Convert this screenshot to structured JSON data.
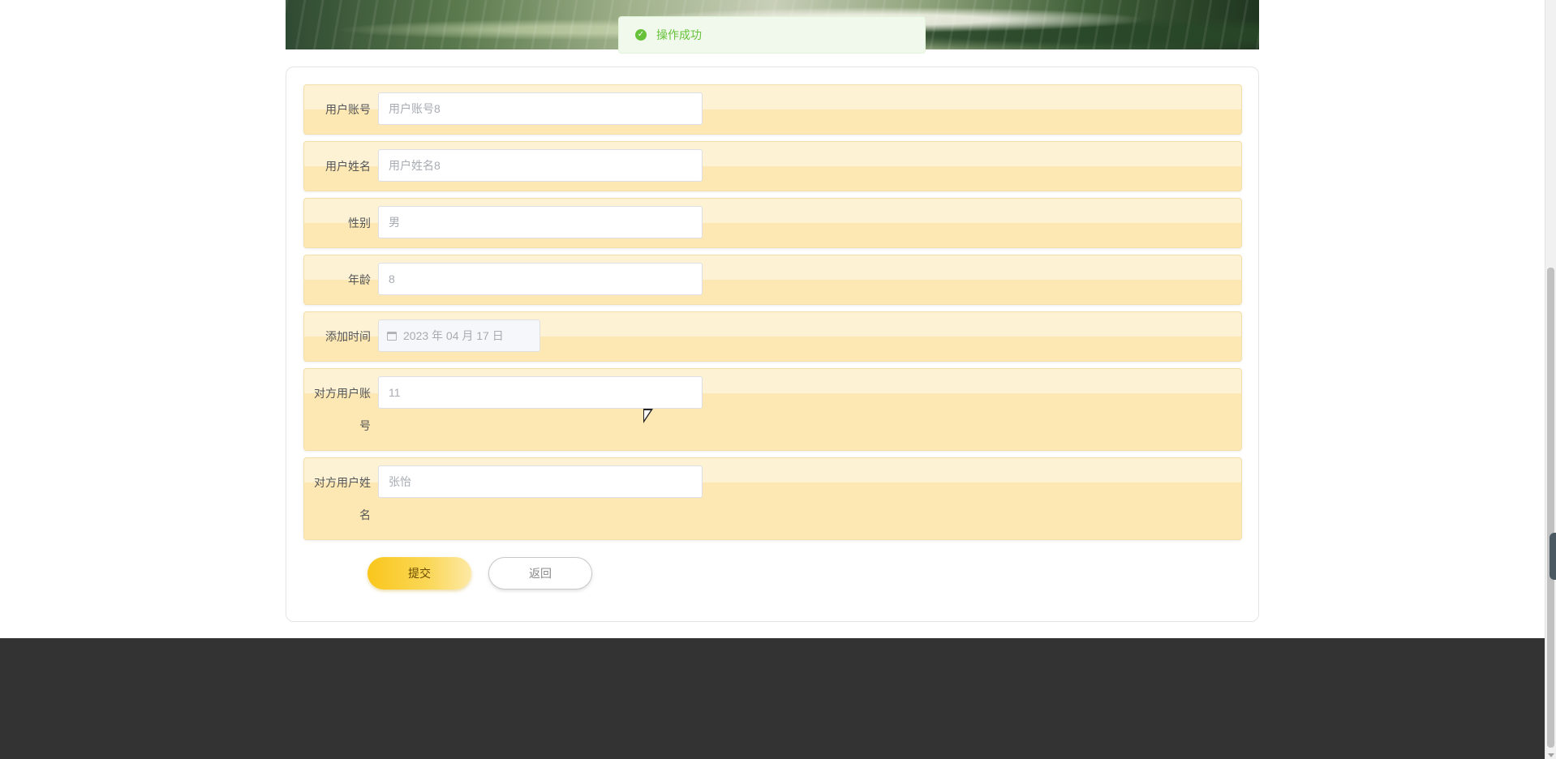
{
  "toast": {
    "message": "操作成功"
  },
  "form": {
    "fields": [
      {
        "label": "用户账号",
        "value": "",
        "placeholder": "用户账号8"
      },
      {
        "label": "用户姓名",
        "value": "",
        "placeholder": "用户姓名8"
      },
      {
        "label": "性别",
        "value": "",
        "placeholder": "男"
      },
      {
        "label": "年龄",
        "value": "",
        "placeholder": "8"
      },
      {
        "label": "添加时间",
        "value": "2023 年 04 月 17 日"
      },
      {
        "label": "对方用户账号",
        "value": "",
        "placeholder": "11"
      },
      {
        "label": "对方用户姓名",
        "value": "",
        "placeholder": "张怡"
      }
    ],
    "submit_label": "提交",
    "back_label": "返回"
  },
  "colors": {
    "accent": "#f9c61b",
    "row_top": "#fdf2d3",
    "row_bottom": "#fde8b3",
    "success": "#67c23a",
    "footer": "#333333"
  }
}
